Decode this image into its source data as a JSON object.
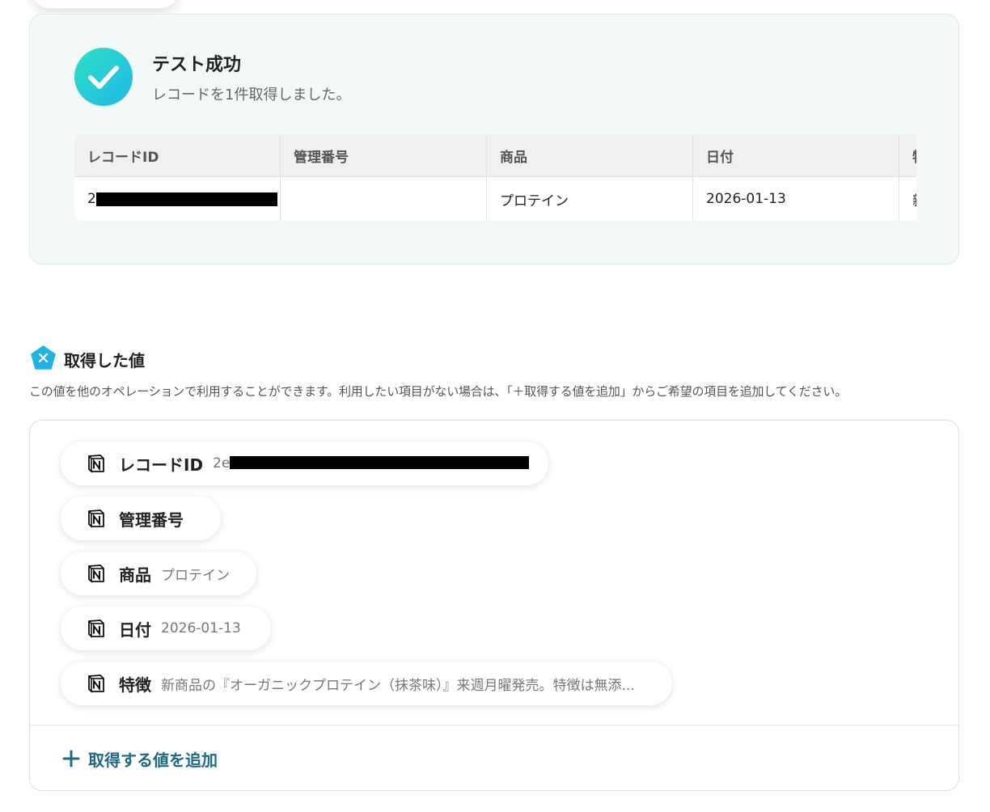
{
  "result": {
    "title": "テスト成功",
    "subtitle": "レコードを1件取得しました。",
    "table": {
      "headers": [
        "レコードID",
        "管理番号",
        "商品",
        "日付",
        "特"
      ],
      "row": {
        "record_id": "2",
        "management_no": "",
        "product": "プロテイン",
        "date": "2026-01-13",
        "feature": "新"
      }
    }
  },
  "section": {
    "icon": "variable-x-icon",
    "title": "取得した値",
    "description": "この値を他のオペレーションで利用することができます。利用したい項目がない場合は、「＋取得する値を追加」からご希望の項目を追加してください。"
  },
  "values": [
    {
      "label": "レコードID",
      "value": "2e"
    },
    {
      "label": "管理番号",
      "value": ""
    },
    {
      "label": "商品",
      "value": "プロテイン"
    },
    {
      "label": "日付",
      "value": "2026-01-13"
    },
    {
      "label": "特徴",
      "value": "新商品の『オーガニックプロテイン（抹茶味）』来週月曜発売。特徴は無添..."
    }
  ],
  "add_button": {
    "label": "取得する値を追加",
    "icon": "plus-icon"
  },
  "colors": {
    "accent": "#1d6a86",
    "success_start": "#2ee0c6",
    "success_end": "#1fb8e6"
  }
}
